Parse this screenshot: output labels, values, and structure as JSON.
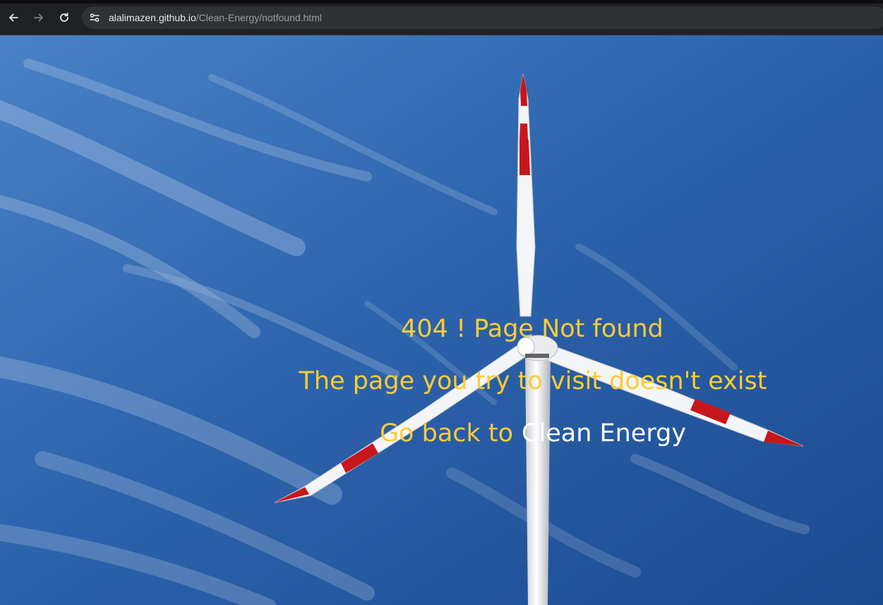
{
  "browser": {
    "url_host": "alalimazen.github.io",
    "url_path": "/Clean-Energy/notfound.html"
  },
  "page": {
    "title": "404 ! Page Not found",
    "subtitle": "The page you try to visit doesn't exist",
    "back_prefix": "Go back to",
    "home_link": "Clean Energy"
  },
  "colors": {
    "message_text": "#ffcc33",
    "link_text": "#ffffff",
    "sky": "#2e65ae",
    "blade_tip": "#c8161d"
  },
  "icons": {
    "back": "arrow-left-icon",
    "forward": "arrow-right-icon",
    "reload": "reload-icon",
    "site_info": "tune-icon"
  }
}
